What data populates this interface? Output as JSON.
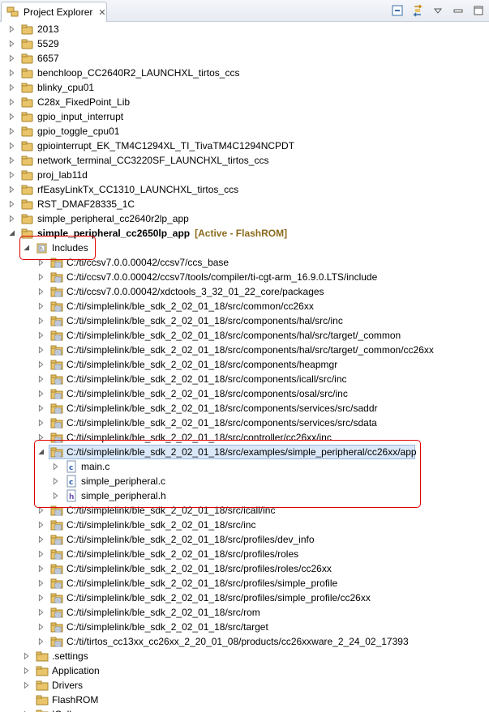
{
  "view": {
    "title": "Project Explorer",
    "close": "✕",
    "toolbar": [
      {
        "name": "collapse-all-icon"
      },
      {
        "name": "link-with-editor-icon"
      },
      {
        "name": "view-menu-icon"
      },
      {
        "name": "minimize-icon"
      },
      {
        "name": "maximize-icon"
      }
    ]
  },
  "projects": [
    {
      "label": "2013",
      "badge": "CCS"
    },
    {
      "label": "5529",
      "badge": "CCS"
    },
    {
      "label": "6657",
      "badge": "CCS"
    },
    {
      "label": "benchloop_CC2640R2_LAUNCHXL_tirtos_ccs",
      "badge": ""
    },
    {
      "label": "blinky_cpu01",
      "badge": ""
    },
    {
      "label": "C28x_FixedPoint_Lib",
      "badge": ""
    },
    {
      "label": "gpio_input_interrupt",
      "badge": ""
    },
    {
      "label": "gpio_toggle_cpu01",
      "badge": ""
    },
    {
      "label": "gpiointerrupt_EK_TM4C1294XL_TI_TivaTM4C1294NCPDT",
      "badge": ""
    },
    {
      "label": "network_terminal_CC3220SF_LAUNCHXL_tirtos_ccs",
      "badge": ""
    },
    {
      "label": "proj_lab11d",
      "badge": ""
    },
    {
      "label": "rfEasyLinkTx_CC1310_LAUNCHXL_tirtos_ccs",
      "badge": ""
    },
    {
      "label": "RST_DMAF28335_1C",
      "badge": ""
    },
    {
      "label": "simple_peripheral_cc2640r2lp_app",
      "badge": "RTSC"
    }
  ],
  "active_project": {
    "label": "simple_peripheral_cc2650lp_app",
    "decoration": "[Active - FlashROM]",
    "badge": "RTSC"
  },
  "includes_label": "Includes",
  "include_paths": [
    "C:/ti/ccsv7.0.0.00042/ccsv7/ccs_base",
    "C:/ti/ccsv7.0.0.00042/ccsv7/tools/compiler/ti-cgt-arm_16.9.0.LTS/include",
    "C:/ti/ccsv7.0.0.00042/xdctools_3_32_01_22_core/packages",
    "C:/ti/simplelink/ble_sdk_2_02_01_18/src/common/cc26xx",
    "C:/ti/simplelink/ble_sdk_2_02_01_18/src/components/hal/src/inc",
    "C:/ti/simplelink/ble_sdk_2_02_01_18/src/components/hal/src/target/_common",
    "C:/ti/simplelink/ble_sdk_2_02_01_18/src/components/hal/src/target/_common/cc26xx",
    "C:/ti/simplelink/ble_sdk_2_02_01_18/src/components/heapmgr",
    "C:/ti/simplelink/ble_sdk_2_02_01_18/src/components/icall/src/inc",
    "C:/ti/simplelink/ble_sdk_2_02_01_18/src/components/osal/src/inc",
    "C:/ti/simplelink/ble_sdk_2_02_01_18/src/components/services/src/saddr",
    "C:/ti/simplelink/ble_sdk_2_02_01_18/src/components/services/src/sdata",
    "C:/ti/simplelink/ble_sdk_2_02_01_18/src/controller/cc26xx/inc"
  ],
  "expanded_include": {
    "label": "C:/ti/simplelink/ble_sdk_2_02_01_18/src/examples/simple_peripheral/cc26xx/app",
    "files": [
      {
        "label": "main.c",
        "type": "c"
      },
      {
        "label": "simple_peripheral.c",
        "type": "c"
      },
      {
        "label": "simple_peripheral.h",
        "type": "h"
      }
    ]
  },
  "include_paths_after": [
    "C:/ti/simplelink/ble_sdk_2_02_01_18/src/icall/inc",
    "C:/ti/simplelink/ble_sdk_2_02_01_18/src/inc",
    "C:/ti/simplelink/ble_sdk_2_02_01_18/src/profiles/dev_info",
    "C:/ti/simplelink/ble_sdk_2_02_01_18/src/profiles/roles",
    "C:/ti/simplelink/ble_sdk_2_02_01_18/src/profiles/roles/cc26xx",
    "C:/ti/simplelink/ble_sdk_2_02_01_18/src/profiles/simple_profile",
    "C:/ti/simplelink/ble_sdk_2_02_01_18/src/profiles/simple_profile/cc26xx",
    "C:/ti/simplelink/ble_sdk_2_02_01_18/src/rom",
    "C:/ti/simplelink/ble_sdk_2_02_01_18/src/target",
    "C:/ti/tirtos_cc13xx_cc26xx_2_20_01_08/products/cc26xxware_2_24_02_17393"
  ],
  "folders": [
    {
      "label": ".settings"
    },
    {
      "label": "Application"
    },
    {
      "label": "Drivers"
    },
    {
      "label": "FlashROM"
    },
    {
      "label": "ICall"
    }
  ],
  "colors": {
    "highlight": "#e00000",
    "selection": "#dbe8f8",
    "decoration": "#8c6a1c",
    "folder": "#e9c46a"
  }
}
